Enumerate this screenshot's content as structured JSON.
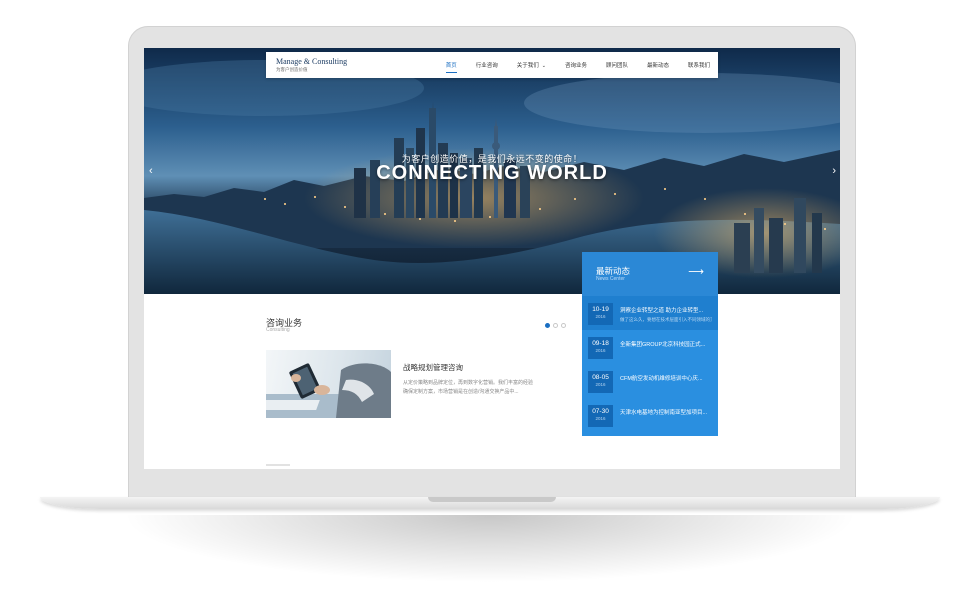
{
  "site": {
    "logo_title": "Manage & Consulting",
    "logo_subtitle": "为客户创造价值"
  },
  "nav": {
    "items": [
      {
        "label": "首页",
        "active": true
      },
      {
        "label": "行业咨询"
      },
      {
        "label": "关于我们",
        "has_dropdown": true
      },
      {
        "label": "咨询业务"
      },
      {
        "label": "顾问团队"
      },
      {
        "label": "最新动态"
      },
      {
        "label": "联系我们"
      }
    ],
    "caret": "⌄"
  },
  "hero": {
    "subtitle": "为客户创造价值，是我们永远不变的使命！",
    "title": "CONNECTING WORLD",
    "prev_arrow": "‹",
    "next_arrow": "›"
  },
  "consulting": {
    "title": "咨询业务",
    "subtitle": "Consulting",
    "carousel_dots": 3,
    "active_dot": 0,
    "card": {
      "title": "战略规划管理咨询",
      "description": "从定价策略到品牌定位，再到数字化营销。我们丰富的经验确保定制方案，市场营销是在创造/沟通交换产品中..."
    }
  },
  "news": {
    "title": "最新动态",
    "subtitle": "News Center",
    "arrow": "⟶",
    "items": [
      {
        "day": "10-19",
        "year": "2016",
        "title": "洞察企业转型之道 助力企业转型...",
        "desc": "做了这么久，要想在技术层面引入不同领域的顶尖...",
        "highlight": true
      },
      {
        "day": "09-18",
        "year": "2016",
        "title": "全新集团GROUP北京科技园正式..."
      },
      {
        "day": "08-05",
        "year": "2016",
        "title": "CFM航空发动机维修培训中心庆..."
      },
      {
        "day": "07-30",
        "year": "2016",
        "title": "天津水电基地为控制南亚型加项目..."
      }
    ]
  },
  "colors": {
    "accent": "#1b6fc2",
    "news_panel": "#2a8fe0",
    "news_date_box": "#1368b5"
  }
}
